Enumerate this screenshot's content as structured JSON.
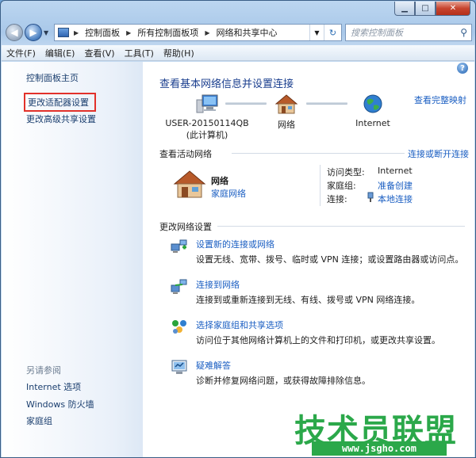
{
  "address": {
    "segments": [
      "控制面板",
      "所有控制面板项",
      "网络和共享中心"
    ],
    "search_placeholder": "搜索控制面板"
  },
  "menu": [
    "文件(F)",
    "编辑(E)",
    "查看(V)",
    "工具(T)",
    "帮助(H)"
  ],
  "sidebar": {
    "home": "控制面板主页",
    "items": [
      "更改适配器设置",
      "更改高级共享设置"
    ],
    "see_also_title": "另请参阅",
    "see_also": [
      "Internet 选项",
      "Windows 防火墙",
      "家庭组"
    ]
  },
  "main": {
    "title": "查看基本网络信息并设置连接",
    "full_map": "查看完整映射",
    "computer_name": "USER-20150114QB",
    "computer_note": "(此计算机)",
    "network_node": "网络",
    "internet_node": "Internet",
    "active_title": "查看活动网络",
    "connect_or_disconnect": "连接或断开连接",
    "active_network": {
      "name": "网络",
      "type": "家庭网络",
      "access_type_label": "访问类型:",
      "access_type_value": "Internet",
      "homegroup_label": "家庭组:",
      "homegroup_value": "准备创建",
      "connection_label": "连接:",
      "connection_value": "本地连接"
    },
    "change_title": "更改网络设置",
    "tasks": [
      {
        "link": "设置新的连接或网络",
        "desc": "设置无线、宽带、拨号、临时或 VPN 连接；或设置路由器或访问点。"
      },
      {
        "link": "连接到网络",
        "desc": "连接到或重新连接到无线、有线、拨号或 VPN 网络连接。"
      },
      {
        "link": "选择家庭组和共享选项",
        "desc": "访问位于其他网络计算机上的文件和打印机，或更改共享设置。"
      },
      {
        "link": "疑难解答",
        "desc": "诊断并修复网络问题，或获得故障排除信息。"
      }
    ]
  },
  "watermark": {
    "text": "技术员联盟",
    "url": "www.jsgho.com"
  }
}
